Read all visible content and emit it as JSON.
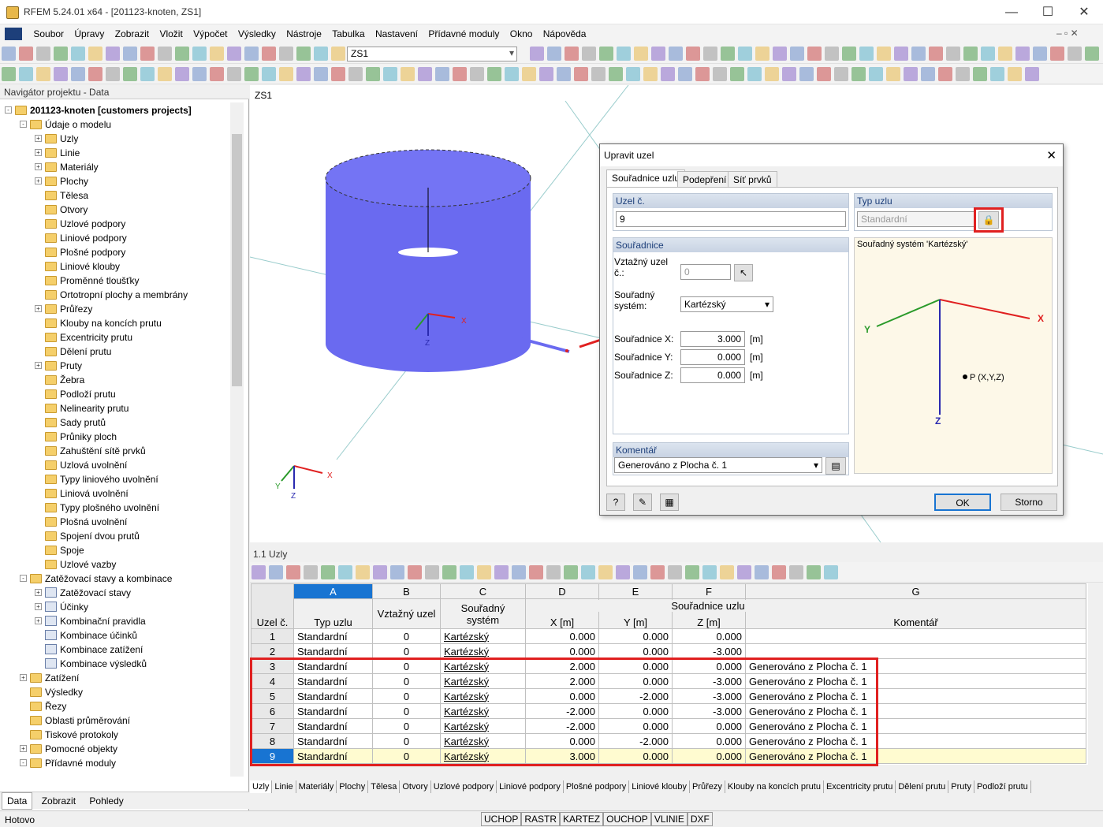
{
  "window": {
    "title": "RFEM 5.24.01 x64 - [201123-knoten, ZS1]"
  },
  "menu": [
    "Soubor",
    "Úpravy",
    "Zobrazit",
    "Vložit",
    "Výpočet",
    "Výsledky",
    "Nástroje",
    "Tabulka",
    "Nastavení",
    "Přídavné moduly",
    "Okno",
    "Nápověda"
  ],
  "toolbar": {
    "case_combo": "ZS1"
  },
  "navigator": {
    "title": "Navigátor projektu - Data",
    "items": [
      {
        "label": "201123-knoten [customers projects]",
        "level": 0,
        "expander": "-",
        "bold": true
      },
      {
        "label": "Údaje o modelu",
        "level": 1,
        "expander": "-"
      },
      {
        "label": "Uzly",
        "level": 2,
        "expander": "+"
      },
      {
        "label": "Linie",
        "level": 2,
        "expander": "+"
      },
      {
        "label": "Materiály",
        "level": 2,
        "expander": "+"
      },
      {
        "label": "Plochy",
        "level": 2,
        "expander": "+"
      },
      {
        "label": "Tělesa",
        "level": 2,
        "expander": ""
      },
      {
        "label": "Otvory",
        "level": 2,
        "expander": ""
      },
      {
        "label": "Uzlové podpory",
        "level": 2,
        "expander": ""
      },
      {
        "label": "Liniové podpory",
        "level": 2,
        "expander": ""
      },
      {
        "label": "Plošné podpory",
        "level": 2,
        "expander": ""
      },
      {
        "label": "Liniové klouby",
        "level": 2,
        "expander": ""
      },
      {
        "label": "Proměnné tloušťky",
        "level": 2,
        "expander": ""
      },
      {
        "label": "Ortotropní plochy a membrány",
        "level": 2,
        "expander": ""
      },
      {
        "label": "Průřezy",
        "level": 2,
        "expander": "+"
      },
      {
        "label": "Klouby na koncích prutu",
        "level": 2,
        "expander": ""
      },
      {
        "label": "Excentricity prutu",
        "level": 2,
        "expander": ""
      },
      {
        "label": "Dělení prutu",
        "level": 2,
        "expander": ""
      },
      {
        "label": "Pruty",
        "level": 2,
        "expander": "+"
      },
      {
        "label": "Žebra",
        "level": 2,
        "expander": ""
      },
      {
        "label": "Podloží prutu",
        "level": 2,
        "expander": ""
      },
      {
        "label": "Nelinearity prutu",
        "level": 2,
        "expander": ""
      },
      {
        "label": "Sady prutů",
        "level": 2,
        "expander": ""
      },
      {
        "label": "Průniky ploch",
        "level": 2,
        "expander": ""
      },
      {
        "label": "Zahuštění sítě prvků",
        "level": 2,
        "expander": ""
      },
      {
        "label": "Uzlová uvolnění",
        "level": 2,
        "expander": ""
      },
      {
        "label": "Typy liniového uvolnění",
        "level": 2,
        "expander": ""
      },
      {
        "label": "Liniová uvolnění",
        "level": 2,
        "expander": ""
      },
      {
        "label": "Typy plošného uvolnění",
        "level": 2,
        "expander": ""
      },
      {
        "label": "Plošná uvolnění",
        "level": 2,
        "expander": ""
      },
      {
        "label": "Spojení dvou prutů",
        "level": 2,
        "expander": ""
      },
      {
        "label": "Spoje",
        "level": 2,
        "expander": ""
      },
      {
        "label": "Uzlové vazby",
        "level": 2,
        "expander": ""
      },
      {
        "label": "Zatěžovací stavy a kombinace",
        "level": 1,
        "expander": "-"
      },
      {
        "label": "Zatěžovací stavy",
        "level": 2,
        "expander": "+"
      },
      {
        "label": "Účinky",
        "level": 2,
        "expander": "+"
      },
      {
        "label": "Kombinační pravidla",
        "level": 2,
        "expander": "+"
      },
      {
        "label": "Kombinace účinků",
        "level": 2,
        "expander": ""
      },
      {
        "label": "Kombinace zatížení",
        "level": 2,
        "expander": ""
      },
      {
        "label": "Kombinace výsledků",
        "level": 2,
        "expander": ""
      },
      {
        "label": "Zatížení",
        "level": 1,
        "expander": "+"
      },
      {
        "label": "Výsledky",
        "level": 1,
        "expander": ""
      },
      {
        "label": "Řezy",
        "level": 1,
        "expander": ""
      },
      {
        "label": "Oblasti průměrování",
        "level": 1,
        "expander": ""
      },
      {
        "label": "Tiskové protokoly",
        "level": 1,
        "expander": ""
      },
      {
        "label": "Pomocné objekty",
        "level": 1,
        "expander": "+"
      },
      {
        "label": "Přídavné moduly",
        "level": 1,
        "expander": "-"
      }
    ],
    "tabs": [
      "Data",
      "Zobrazit",
      "Pohledy"
    ]
  },
  "view": {
    "label": "ZS1",
    "axes": {
      "x": "X",
      "y": "Y",
      "z": "Z"
    }
  },
  "dialog": {
    "title": "Upravit uzel",
    "tabs": [
      "Souřadnice uzlu",
      "Podepření",
      "Síť prvků"
    ],
    "node_no_label": "Uzel č.",
    "node_no": "9",
    "node_type_label": "Typ uzlu",
    "node_type": "Standardní",
    "coords_label": "Souřadnice",
    "ref_node_label": "Vztažný uzel č.:",
    "ref_node": "0",
    "coord_sys_label": "Souřadný systém:",
    "coord_sys": "Kartézský",
    "x_label": "Souřadnice X:",
    "x_val": "3.000",
    "y_label": "Souřadnice Y:",
    "y_val": "0.000",
    "z_label": "Souřadnice Z:",
    "z_val": "0.000",
    "unit": "[m]",
    "preview_title": "Souřadný systém 'Kartézský'",
    "preview_point": "P (X,Y,Z)",
    "comment_label": "Komentář",
    "comment": "Generováno z Plocha č. 1",
    "ok": "OK",
    "cancel": "Storno"
  },
  "table": {
    "title": "1.1 Uzly",
    "col_letters": [
      "A",
      "B",
      "C",
      "D",
      "E",
      "F",
      "G"
    ],
    "head_row_no": "Uzel č.",
    "head_type": "Typ uzlu",
    "head_ref": "Vztažný uzel",
    "head_sys": "Souřadný systém",
    "head_coords": "Souřadnice uzlu",
    "head_x": "X [m]",
    "head_y": "Y [m]",
    "head_z": "Z [m]",
    "head_comment": "Komentář",
    "rows": [
      {
        "no": "1",
        "type": "Standardní",
        "ref": "0",
        "sys": "Kartézský",
        "x": "0.000",
        "y": "0.000",
        "z": "0.000",
        "comment": ""
      },
      {
        "no": "2",
        "type": "Standardní",
        "ref": "0",
        "sys": "Kartézský",
        "x": "0.000",
        "y": "0.000",
        "z": "-3.000",
        "comment": ""
      },
      {
        "no": "3",
        "type": "Standardní",
        "ref": "0",
        "sys": "Kartézský",
        "x": "2.000",
        "y": "0.000",
        "z": "0.000",
        "comment": "Generováno z Plocha č. 1"
      },
      {
        "no": "4",
        "type": "Standardní",
        "ref": "0",
        "sys": "Kartézský",
        "x": "2.000",
        "y": "0.000",
        "z": "-3.000",
        "comment": "Generováno z Plocha č. 1"
      },
      {
        "no": "5",
        "type": "Standardní",
        "ref": "0",
        "sys": "Kartézský",
        "x": "0.000",
        "y": "-2.000",
        "z": "-3.000",
        "comment": "Generováno z Plocha č. 1"
      },
      {
        "no": "6",
        "type": "Standardní",
        "ref": "0",
        "sys": "Kartézský",
        "x": "-2.000",
        "y": "0.000",
        "z": "-3.000",
        "comment": "Generováno z Plocha č. 1"
      },
      {
        "no": "7",
        "type": "Standardní",
        "ref": "0",
        "sys": "Kartézský",
        "x": "-2.000",
        "y": "0.000",
        "z": "0.000",
        "comment": "Generováno z Plocha č. 1"
      },
      {
        "no": "8",
        "type": "Standardní",
        "ref": "0",
        "sys": "Kartézský",
        "x": "0.000",
        "y": "-2.000",
        "z": "0.000",
        "comment": "Generováno z Plocha č. 1"
      },
      {
        "no": "9",
        "type": "Standardní",
        "ref": "0",
        "sys": "Kartézský",
        "x": "3.000",
        "y": "0.000",
        "z": "0.000",
        "comment": "Generováno z Plocha č. 1"
      }
    ],
    "bottom_tabs": [
      "Uzly",
      "Linie",
      "Materiály",
      "Plochy",
      "Tělesa",
      "Otvory",
      "Uzlové podpory",
      "Liniové podpory",
      "Plošné podpory",
      "Liniové klouby",
      "Průřezy",
      "Klouby na koncích prutu",
      "Excentricity prutu",
      "Dělení prutu",
      "Pruty",
      "Podloží prutu"
    ]
  },
  "status": {
    "text": "Hotovo",
    "toggles": [
      "UCHOP",
      "RASTR",
      "KARTEZ",
      "OUCHOP",
      "VLINIE",
      "DXF"
    ]
  },
  "colors": {
    "accent": "#e02020",
    "cylinder": "#6a6af0",
    "selection": "#1874d2"
  }
}
